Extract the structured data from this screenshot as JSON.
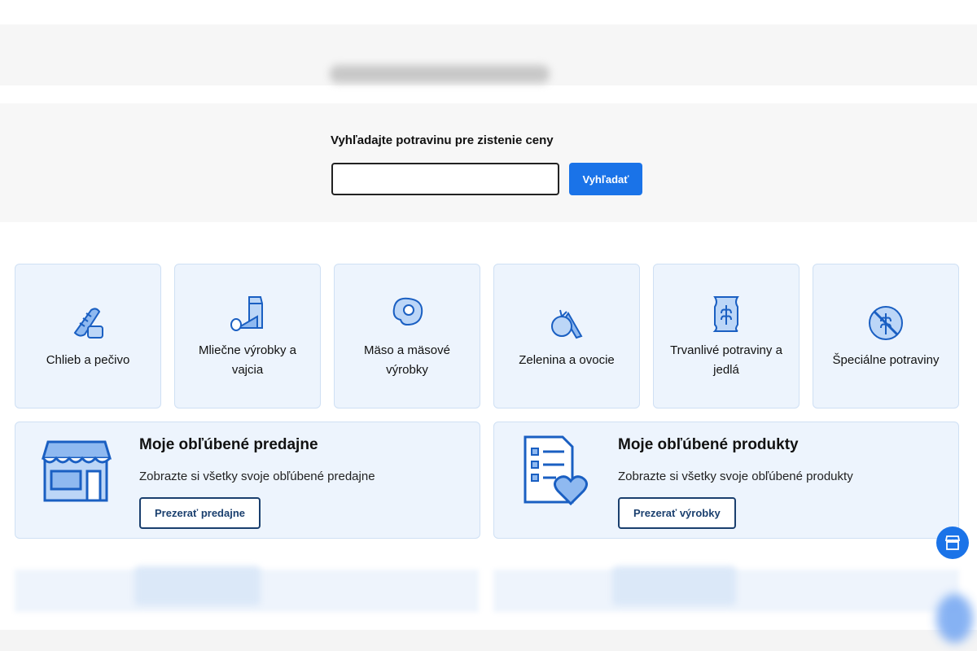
{
  "search": {
    "title": "Vyhľadajte potravinu pre zistenie ceny",
    "input_value": "",
    "button_label": "Vyhľadať"
  },
  "categories": [
    {
      "label": "Chlieb a pečivo",
      "icon": "bread-icon"
    },
    {
      "label": "Mliečne výrobky a vajcia",
      "icon": "dairy-icon"
    },
    {
      "label": "Mäso a mäsové výrobky",
      "icon": "meat-icon"
    },
    {
      "label": "Zelenina a ovocie",
      "icon": "vegetables-icon"
    },
    {
      "label": "Trvanlivé potraviny a jedlá",
      "icon": "grain-sack-icon"
    },
    {
      "label": "Špeciálne potraviny",
      "icon": "gluten-free-icon"
    }
  ],
  "favorites": {
    "stores": {
      "title": "Moje obľúbené predajne",
      "text": "Zobrazte si všetky svoje obľúbené predajne",
      "button_label": "Prezerať predajne",
      "icon": "store-icon"
    },
    "products": {
      "title": "Moje obľúbené produkty",
      "text": "Zobrazte si všetky svoje obľúbené produkty",
      "button_label": "Prezerať výrobky",
      "icon": "heart-list-icon"
    }
  },
  "colors": {
    "accent": "#1a73e8",
    "card_bg": "#edf4fd",
    "button_border": "#1a3f6e"
  }
}
